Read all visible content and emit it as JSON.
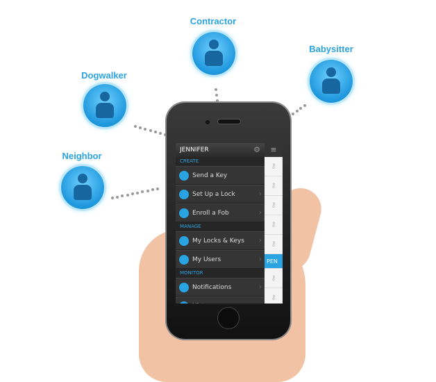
{
  "roles": [
    "Contractor",
    "Babysitter",
    "Dogwalker",
    "Neighbor"
  ],
  "app": {
    "user": "JENNIFER",
    "sections": [
      {
        "title": "CREATE",
        "items": [
          "Send a Key",
          "Set Up a Lock",
          "Enroll a Fob"
        ]
      },
      {
        "title": "MANAGE",
        "items": [
          "My Locks & Keys",
          "My Users"
        ]
      },
      {
        "title": "MONITOR",
        "items": [
          "Notifications",
          "History"
        ]
      }
    ],
    "pending_label": "PEN"
  },
  "colors": {
    "accent": "#2aa3e2"
  }
}
